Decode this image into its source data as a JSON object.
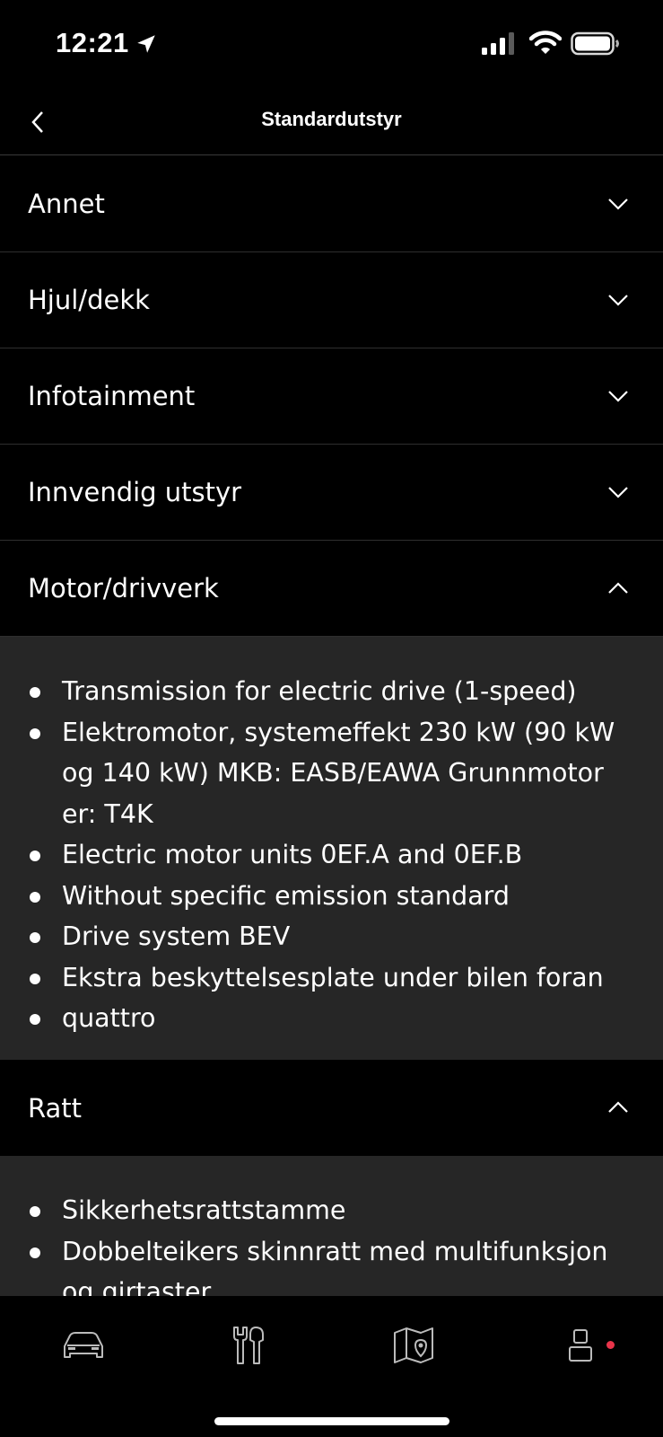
{
  "status_bar": {
    "time": "12:21"
  },
  "header": {
    "title": "Standardutstyr"
  },
  "sections": [
    {
      "label": "Annet",
      "expanded": false
    },
    {
      "label": "Hjul/dekk",
      "expanded": false
    },
    {
      "label": "Infotainment",
      "expanded": false
    },
    {
      "label": "Innvendig utstyr",
      "expanded": false
    },
    {
      "label": "Motor/drivverk",
      "expanded": true,
      "items": [
        "Transmission for electric drive (1-speed)",
        "Elektromotor, systemeffekt 230 kW (90 kW og 140 kW) MKB: EASB/EAWA Grunnmotor er: T4K",
        "Electric motor units 0EF.A and 0EF.B",
        "Without specific emission standard",
        "Drive system BEV",
        "Ekstra beskyttelsesplate under bilen foran",
        "quattro"
      ]
    },
    {
      "label": "Ratt",
      "expanded": true,
      "items": [
        "Sikkerhetsrattstamme",
        "Dobbelteikers skinnratt med multifunksjon og girtaster"
      ]
    }
  ],
  "tab_bar": {
    "tabs": [
      {
        "name": "car-icon"
      },
      {
        "name": "tools-icon"
      },
      {
        "name": "map-icon"
      },
      {
        "name": "profile-icon",
        "badge": true
      }
    ],
    "badge_color": "#e8344a"
  }
}
